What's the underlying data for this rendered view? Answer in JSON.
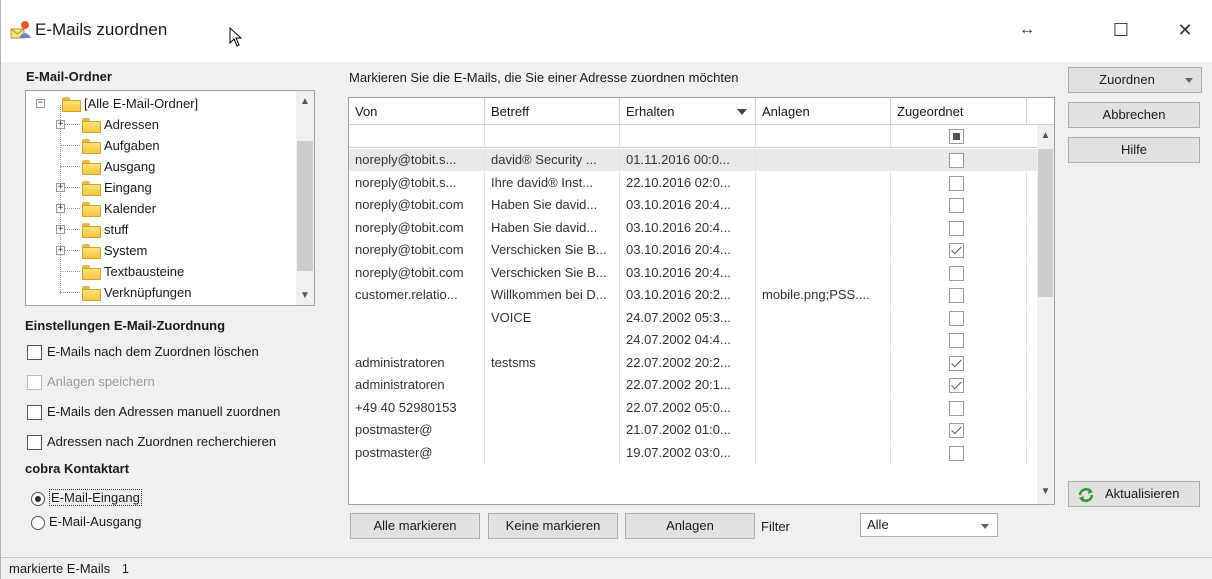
{
  "window": {
    "title": "E-Mails zuordnen",
    "restore_glyph": "↔",
    "maximize_glyph": "☐",
    "close_glyph": "✕"
  },
  "left": {
    "folder_section_title": "E-Mail-Ordner",
    "folders": [
      {
        "label": "[Alle E-Mail-Ordner]",
        "level": 0,
        "expander": "−"
      },
      {
        "label": "Adressen",
        "level": 1,
        "expander": "+"
      },
      {
        "label": "Aufgaben",
        "level": 1,
        "expander": ""
      },
      {
        "label": "Ausgang",
        "level": 1,
        "expander": ""
      },
      {
        "label": "Eingang",
        "level": 1,
        "expander": "+"
      },
      {
        "label": "Kalender",
        "level": 1,
        "expander": "+"
      },
      {
        "label": "stuff",
        "level": 1,
        "expander": "+"
      },
      {
        "label": "System",
        "level": 1,
        "expander": "+"
      },
      {
        "label": "Textbausteine",
        "level": 1,
        "expander": ""
      },
      {
        "label": "Verknüpfungen",
        "level": 1,
        "expander": ""
      }
    ],
    "settings_title": "Einstellungen E-Mail-Zuordnung",
    "opt_delete": "E-Mails nach dem Zuordnen löschen",
    "opt_attachments": "Anlagen speichern",
    "opt_manual": "E-Mails den Adressen manuell zuordnen",
    "opt_research": "Adressen nach Zuordnen recherchieren",
    "contact_title": "cobra Kontaktart",
    "radio_in": "E-Mail-Eingang",
    "radio_out": "E-Mail-Ausgang"
  },
  "grid": {
    "instruction": "Markieren Sie die E-Mails, die Sie einer Adresse zuordnen möchten",
    "columns": [
      "Von",
      "Betreff",
      "Erhalten",
      "Anlagen",
      "Zugeordnet"
    ],
    "rows": [
      {
        "von": "noreply@tobit.s...",
        "betreff": "david® Security ...",
        "erhalten": "01.11.2016 00:0...",
        "anlagen": "",
        "assigned": false
      },
      {
        "von": "noreply@tobit.s...",
        "betreff": "Ihre david® Inst...",
        "erhalten": "22.10.2016 02:0...",
        "anlagen": "",
        "assigned": false
      },
      {
        "von": "noreply@tobit.com",
        "betreff": "Haben Sie david...",
        "erhalten": "03.10.2016 20:4...",
        "anlagen": "",
        "assigned": false
      },
      {
        "von": "noreply@tobit.com",
        "betreff": "Haben Sie david...",
        "erhalten": "03.10.2016 20:4...",
        "anlagen": "",
        "assigned": false
      },
      {
        "von": "noreply@tobit.com",
        "betreff": "Verschicken Sie B...",
        "erhalten": "03.10.2016 20:4...",
        "anlagen": "",
        "assigned": true
      },
      {
        "von": "noreply@tobit.com",
        "betreff": "Verschicken Sie B...",
        "erhalten": "03.10.2016 20:4...",
        "anlagen": "",
        "assigned": false
      },
      {
        "von": "customer.relatio...",
        "betreff": "Willkommen bei D...",
        "erhalten": "03.10.2016 20:2...",
        "anlagen": "mobile.png;PSS....",
        "assigned": false
      },
      {
        "von": "",
        "betreff": "VOICE",
        "erhalten": "24.07.2002 05:3...",
        "anlagen": "",
        "assigned": false
      },
      {
        "von": "",
        "betreff": "",
        "erhalten": "24.07.2002 04:4...",
        "anlagen": "",
        "assigned": false
      },
      {
        "von": "administratoren",
        "betreff": "testsms",
        "erhalten": "22.07.2002 20:2...",
        "anlagen": "",
        "assigned": true
      },
      {
        "von": "administratoren",
        "betreff": "",
        "erhalten": "22.07.2002 20:1...",
        "anlagen": "",
        "assigned": true
      },
      {
        "von": "+49 40 52980153",
        "betreff": "",
        "erhalten": "22.07.2002 05:0...",
        "anlagen": "",
        "assigned": false
      },
      {
        "von": "postmaster@",
        "betreff": "",
        "erhalten": "21.07.2002 01:0...",
        "anlagen": "",
        "assigned": true
      },
      {
        "von": "postmaster@",
        "betreff": "",
        "erhalten": "19.07.2002 03:0...",
        "anlagen": "",
        "assigned": false
      }
    ]
  },
  "buttons": {
    "select_all": "Alle markieren",
    "select_none": "Keine markieren",
    "attachments": "Anlagen",
    "filter_label": "Filter",
    "filter_value": "Alle",
    "assign": "Zuordnen",
    "cancel": "Abbrechen",
    "help": "Hilfe",
    "refresh": "Aktualisieren"
  },
  "status": {
    "label": "markierte E-Mails",
    "count": "1"
  }
}
